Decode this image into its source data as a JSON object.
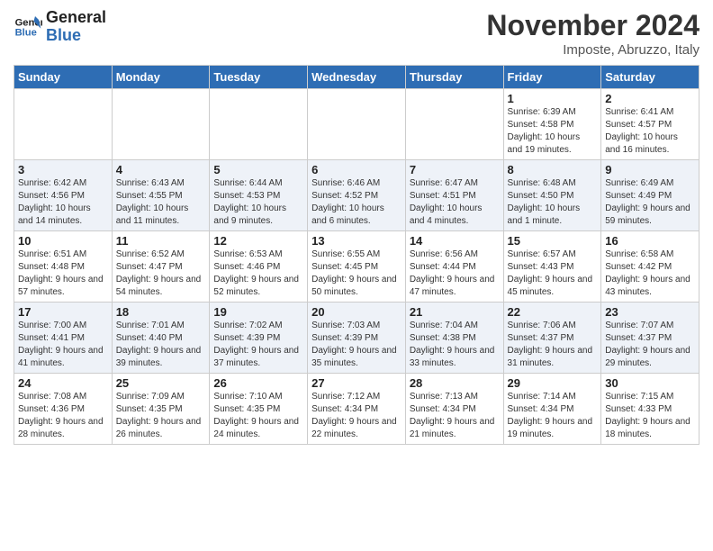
{
  "header": {
    "logo_line1": "General",
    "logo_line2": "Blue",
    "month_title": "November 2024",
    "location": "Imposte, Abruzzo, Italy"
  },
  "columns": [
    "Sunday",
    "Monday",
    "Tuesday",
    "Wednesday",
    "Thursday",
    "Friday",
    "Saturday"
  ],
  "rows": [
    [
      {
        "day": "",
        "info": ""
      },
      {
        "day": "",
        "info": ""
      },
      {
        "day": "",
        "info": ""
      },
      {
        "day": "",
        "info": ""
      },
      {
        "day": "",
        "info": ""
      },
      {
        "day": "1",
        "info": "Sunrise: 6:39 AM\nSunset: 4:58 PM\nDaylight: 10 hours and 19 minutes."
      },
      {
        "day": "2",
        "info": "Sunrise: 6:41 AM\nSunset: 4:57 PM\nDaylight: 10 hours and 16 minutes."
      }
    ],
    [
      {
        "day": "3",
        "info": "Sunrise: 6:42 AM\nSunset: 4:56 PM\nDaylight: 10 hours and 14 minutes."
      },
      {
        "day": "4",
        "info": "Sunrise: 6:43 AM\nSunset: 4:55 PM\nDaylight: 10 hours and 11 minutes."
      },
      {
        "day": "5",
        "info": "Sunrise: 6:44 AM\nSunset: 4:53 PM\nDaylight: 10 hours and 9 minutes."
      },
      {
        "day": "6",
        "info": "Sunrise: 6:46 AM\nSunset: 4:52 PM\nDaylight: 10 hours and 6 minutes."
      },
      {
        "day": "7",
        "info": "Sunrise: 6:47 AM\nSunset: 4:51 PM\nDaylight: 10 hours and 4 minutes."
      },
      {
        "day": "8",
        "info": "Sunrise: 6:48 AM\nSunset: 4:50 PM\nDaylight: 10 hours and 1 minute."
      },
      {
        "day": "9",
        "info": "Sunrise: 6:49 AM\nSunset: 4:49 PM\nDaylight: 9 hours and 59 minutes."
      }
    ],
    [
      {
        "day": "10",
        "info": "Sunrise: 6:51 AM\nSunset: 4:48 PM\nDaylight: 9 hours and 57 minutes."
      },
      {
        "day": "11",
        "info": "Sunrise: 6:52 AM\nSunset: 4:47 PM\nDaylight: 9 hours and 54 minutes."
      },
      {
        "day": "12",
        "info": "Sunrise: 6:53 AM\nSunset: 4:46 PM\nDaylight: 9 hours and 52 minutes."
      },
      {
        "day": "13",
        "info": "Sunrise: 6:55 AM\nSunset: 4:45 PM\nDaylight: 9 hours and 50 minutes."
      },
      {
        "day": "14",
        "info": "Sunrise: 6:56 AM\nSunset: 4:44 PM\nDaylight: 9 hours and 47 minutes."
      },
      {
        "day": "15",
        "info": "Sunrise: 6:57 AM\nSunset: 4:43 PM\nDaylight: 9 hours and 45 minutes."
      },
      {
        "day": "16",
        "info": "Sunrise: 6:58 AM\nSunset: 4:42 PM\nDaylight: 9 hours and 43 minutes."
      }
    ],
    [
      {
        "day": "17",
        "info": "Sunrise: 7:00 AM\nSunset: 4:41 PM\nDaylight: 9 hours and 41 minutes."
      },
      {
        "day": "18",
        "info": "Sunrise: 7:01 AM\nSunset: 4:40 PM\nDaylight: 9 hours and 39 minutes."
      },
      {
        "day": "19",
        "info": "Sunrise: 7:02 AM\nSunset: 4:39 PM\nDaylight: 9 hours and 37 minutes."
      },
      {
        "day": "20",
        "info": "Sunrise: 7:03 AM\nSunset: 4:39 PM\nDaylight: 9 hours and 35 minutes."
      },
      {
        "day": "21",
        "info": "Sunrise: 7:04 AM\nSunset: 4:38 PM\nDaylight: 9 hours and 33 minutes."
      },
      {
        "day": "22",
        "info": "Sunrise: 7:06 AM\nSunset: 4:37 PM\nDaylight: 9 hours and 31 minutes."
      },
      {
        "day": "23",
        "info": "Sunrise: 7:07 AM\nSunset: 4:37 PM\nDaylight: 9 hours and 29 minutes."
      }
    ],
    [
      {
        "day": "24",
        "info": "Sunrise: 7:08 AM\nSunset: 4:36 PM\nDaylight: 9 hours and 28 minutes."
      },
      {
        "day": "25",
        "info": "Sunrise: 7:09 AM\nSunset: 4:35 PM\nDaylight: 9 hours and 26 minutes."
      },
      {
        "day": "26",
        "info": "Sunrise: 7:10 AM\nSunset: 4:35 PM\nDaylight: 9 hours and 24 minutes."
      },
      {
        "day": "27",
        "info": "Sunrise: 7:12 AM\nSunset: 4:34 PM\nDaylight: 9 hours and 22 minutes."
      },
      {
        "day": "28",
        "info": "Sunrise: 7:13 AM\nSunset: 4:34 PM\nDaylight: 9 hours and 21 minutes."
      },
      {
        "day": "29",
        "info": "Sunrise: 7:14 AM\nSunset: 4:34 PM\nDaylight: 9 hours and 19 minutes."
      },
      {
        "day": "30",
        "info": "Sunrise: 7:15 AM\nSunset: 4:33 PM\nDaylight: 9 hours and 18 minutes."
      }
    ]
  ]
}
